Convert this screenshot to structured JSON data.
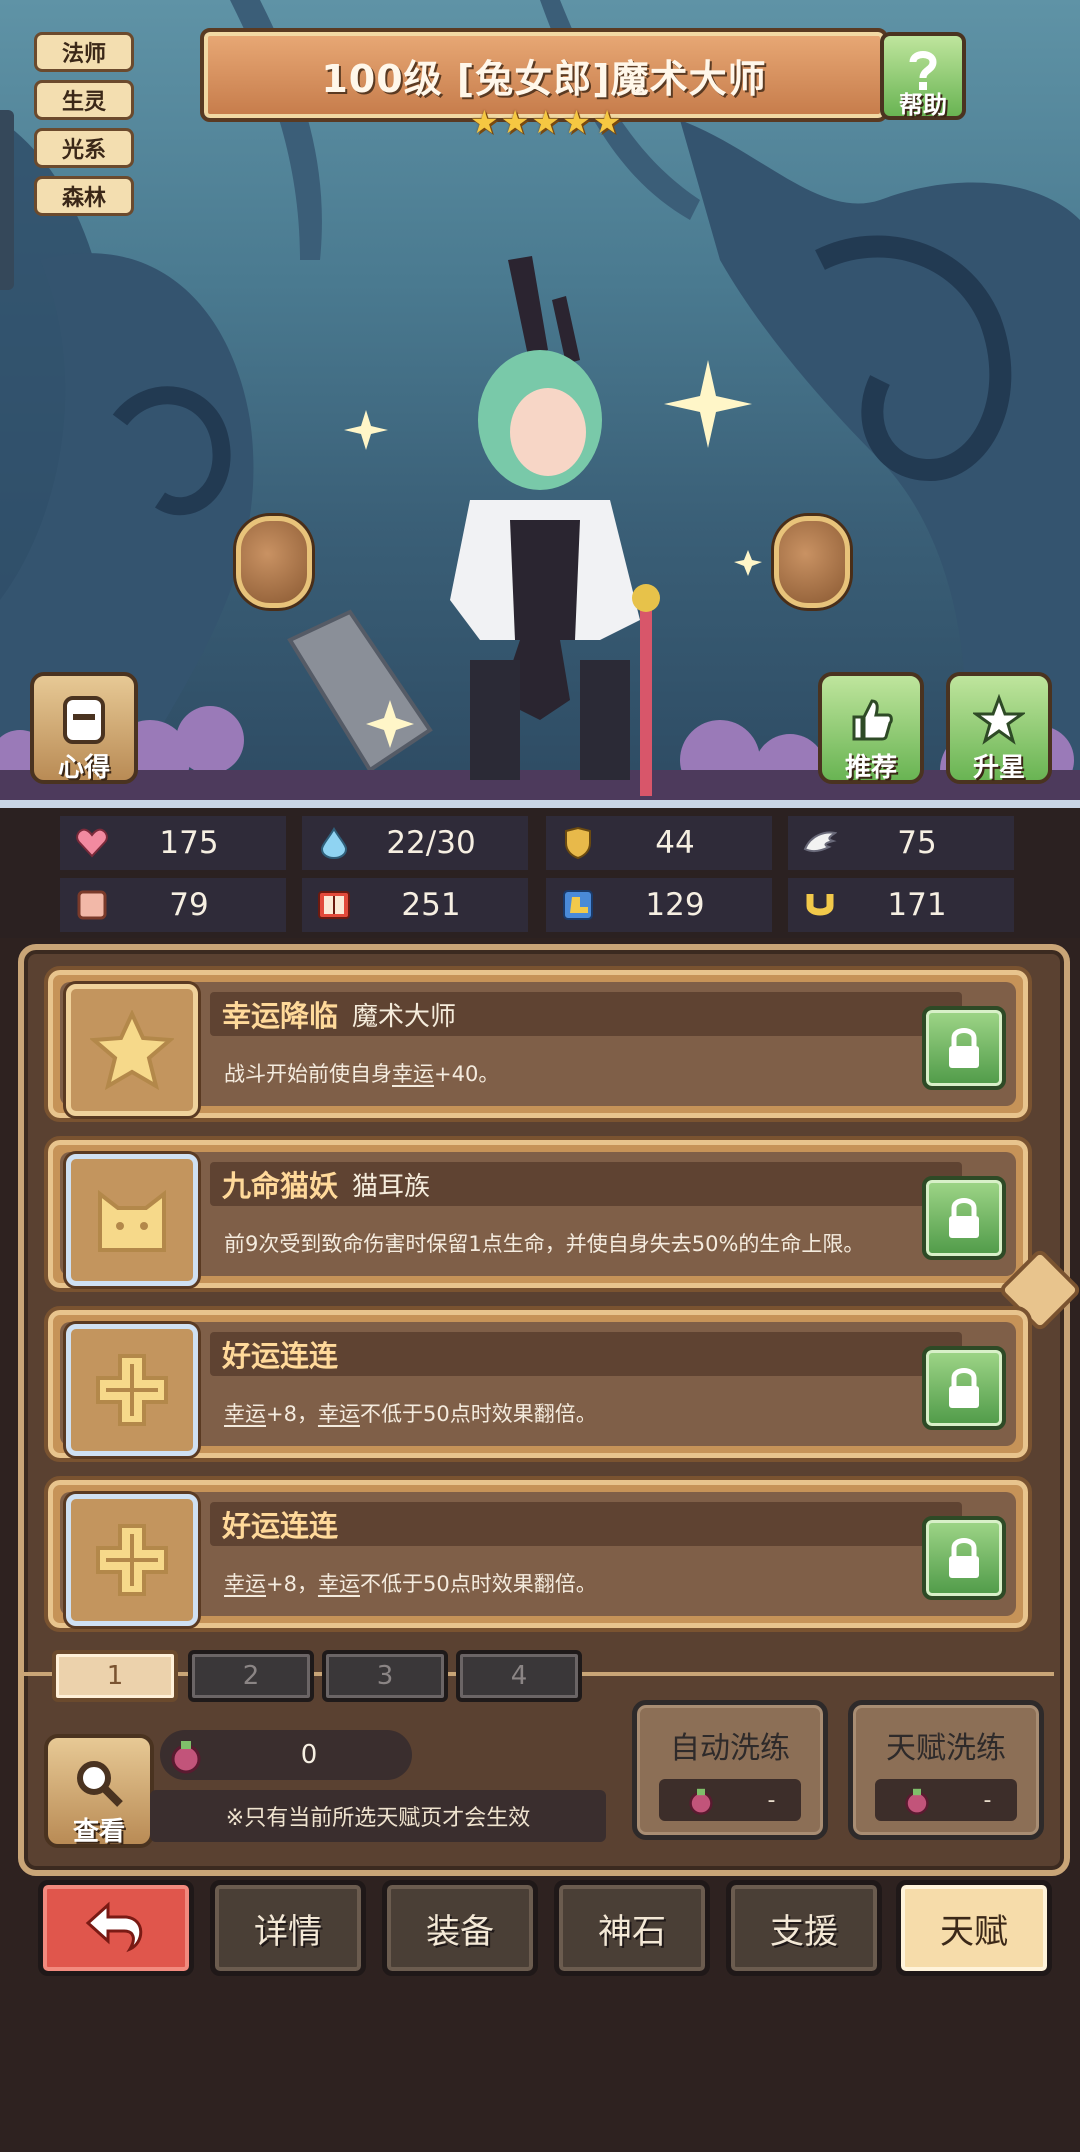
{
  "tags": [
    "法师",
    "生灵",
    "光系",
    "森林"
  ],
  "title": "100级  [兔女郎]魔术大师",
  "stars": [
    "★",
    "★",
    "★",
    "★",
    "★"
  ],
  "help_label": "帮助",
  "left_button_label": "心得",
  "recommend_label": "推荐",
  "upgrade_star_label": "升星",
  "stats": [
    {
      "icon": "heart-icon",
      "value": "175"
    },
    {
      "icon": "mana-drop-icon",
      "value": "22/30"
    },
    {
      "icon": "shield-icon",
      "value": "44"
    },
    {
      "icon": "wing-icon",
      "value": "75"
    },
    {
      "icon": "fist-icon",
      "value": "79"
    },
    {
      "icon": "book-icon",
      "value": "251"
    },
    {
      "icon": "boot-icon",
      "value": "129"
    },
    {
      "icon": "horseshoe-icon",
      "value": "171"
    }
  ],
  "talents": [
    {
      "name": "幸运降临",
      "sub": "魔术大师",
      "desc_pre": "战斗开始前使自身",
      "desc_kw1": "幸运",
      "desc_mid": "+40。",
      "desc_kw2": "",
      "desc_post": "",
      "icon": "star-icon"
    },
    {
      "name": "九命猫妖",
      "sub": "猫耳族",
      "desc_pre": "前9次受到致命伤害时保留1点生命，并使自身失去50%的生命上限。",
      "desc_kw1": "",
      "desc_mid": "",
      "desc_kw2": "",
      "desc_post": "",
      "icon": "cat-icon"
    },
    {
      "name": "好运连连",
      "sub": "",
      "desc_pre": "",
      "desc_kw1": "幸运",
      "desc_mid": "+8，",
      "desc_kw2": "幸运",
      "desc_post": "不低于50点时效果翻倍。",
      "icon": "clover-icon"
    },
    {
      "name": "好运连连",
      "sub": "",
      "desc_pre": "",
      "desc_kw1": "幸运",
      "desc_mid": "+8，",
      "desc_kw2": "幸运",
      "desc_post": "不低于50点时效果翻倍。",
      "icon": "clover-icon"
    }
  ],
  "page_tabs": [
    "1",
    "2",
    "3",
    "4"
  ],
  "view_label": "查看",
  "gem_count": "0",
  "note": "※只有当前所选天赋页才会生效",
  "auto_refine": {
    "label": "自动洗练",
    "cost": "-"
  },
  "talent_refine": {
    "label": "天赋洗练",
    "cost": "-"
  },
  "nav": [
    "详情",
    "装备",
    "神石",
    "支援",
    "天赋"
  ],
  "colors": {
    "accent": "#c9a577",
    "active_tab": "#ecd2ac",
    "back_button": "#e0564c",
    "lock_green": "#69b453"
  }
}
